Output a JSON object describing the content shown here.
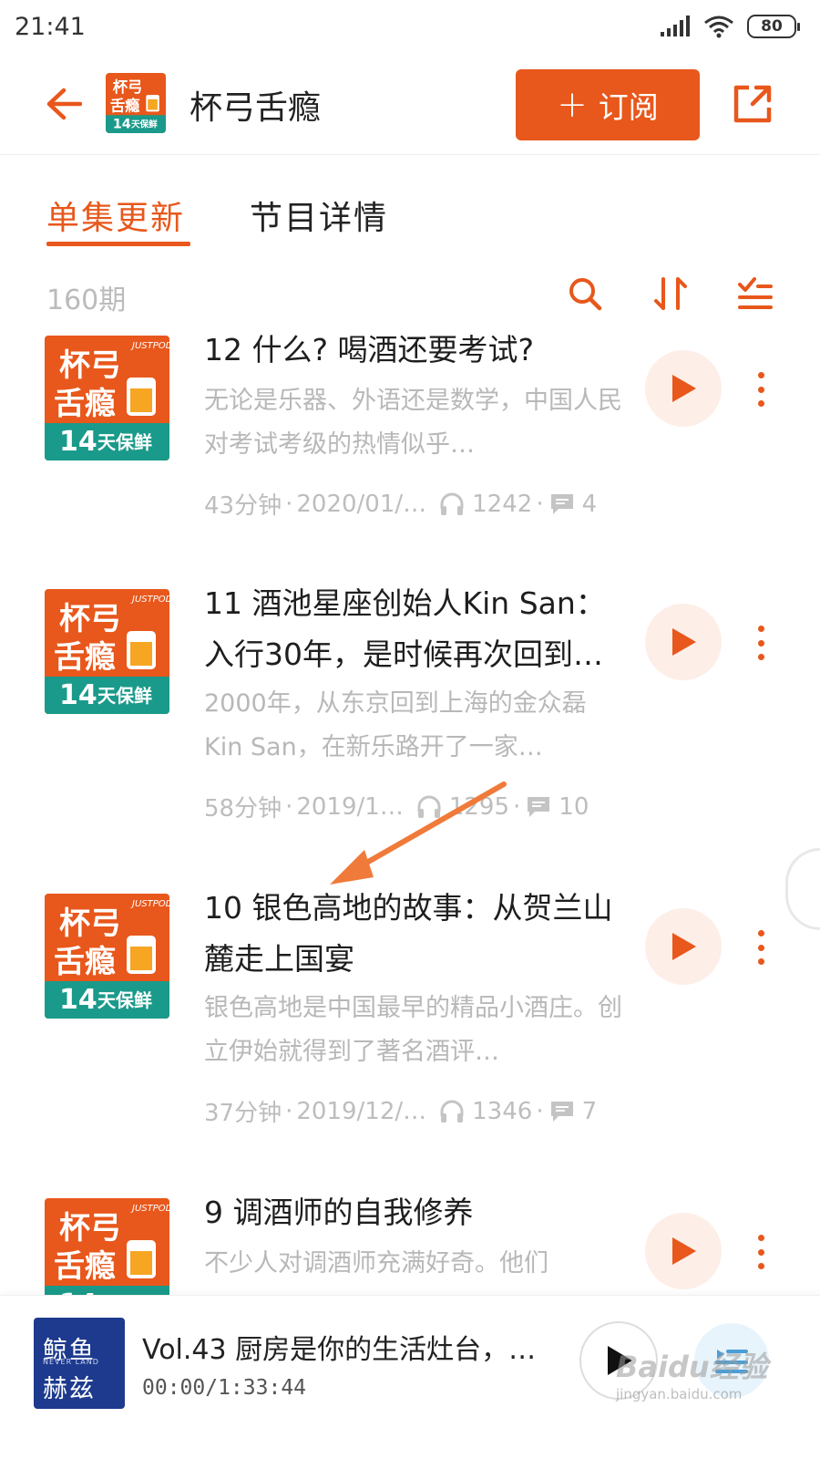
{
  "status_bar": {
    "time": "21:41",
    "battery": "80"
  },
  "header": {
    "title": "杯弓舌瘾",
    "subscribe_label": "订阅",
    "subscribe_plus": "+"
  },
  "tabs": [
    {
      "label": "单集更新",
      "active": true
    },
    {
      "label": "节目详情",
      "active": false
    }
  ],
  "toolbar": {
    "episode_count": "160期"
  },
  "cover": {
    "line1": "杯弓",
    "line2": "舌瘾",
    "badge_num": "14",
    "badge_text": "天保鲜",
    "brand": "JUSTPOD"
  },
  "episodes": [
    {
      "title": "12 什么? 喝酒还要考试?",
      "description": "无论是乐器、外语还是数学，中国人民对考试考级的热情似乎…",
      "duration": "43分钟",
      "date": "2020/01/…",
      "plays": "1242",
      "comments": "4"
    },
    {
      "title": "11 酒池星座创始人Kin San：入行30年，是时候再次回到…",
      "description": "2000年，从东京回到上海的金众磊Kin San，在新乐路开了一家…",
      "duration": "58分钟",
      "date": "2019/1…",
      "plays": "1295",
      "comments": "10"
    },
    {
      "title": "10 银色高地的故事：从贺兰山麓走上国宴",
      "description": "银色高地是中国最早的精品小酒庄。创立伊始就得到了著名酒评…",
      "duration": "37分钟",
      "date": "2019/12/…",
      "plays": "1346",
      "comments": "7"
    },
    {
      "title": "9 调酒师的自我修养",
      "description": "不少人对调酒师充满好奇。他们",
      "duration": "",
      "date": "",
      "plays": "",
      "comments": ""
    }
  ],
  "player": {
    "cover_line1": "鲸鱼",
    "cover_line2": "赫兹",
    "cover_small": "NEVER LAND",
    "title": "Vol.43 厨房是你的生活灶台，…",
    "time": "00:00/1:33:44"
  },
  "watermark": {
    "main": "Baidu经验",
    "sub": "jingyan.baidu.com"
  },
  "colors": {
    "accent": "#e8571b",
    "play_bg": "#fdeee8",
    "cover_orange": "#e8571b",
    "cover_teal": "#1a9a8a"
  }
}
